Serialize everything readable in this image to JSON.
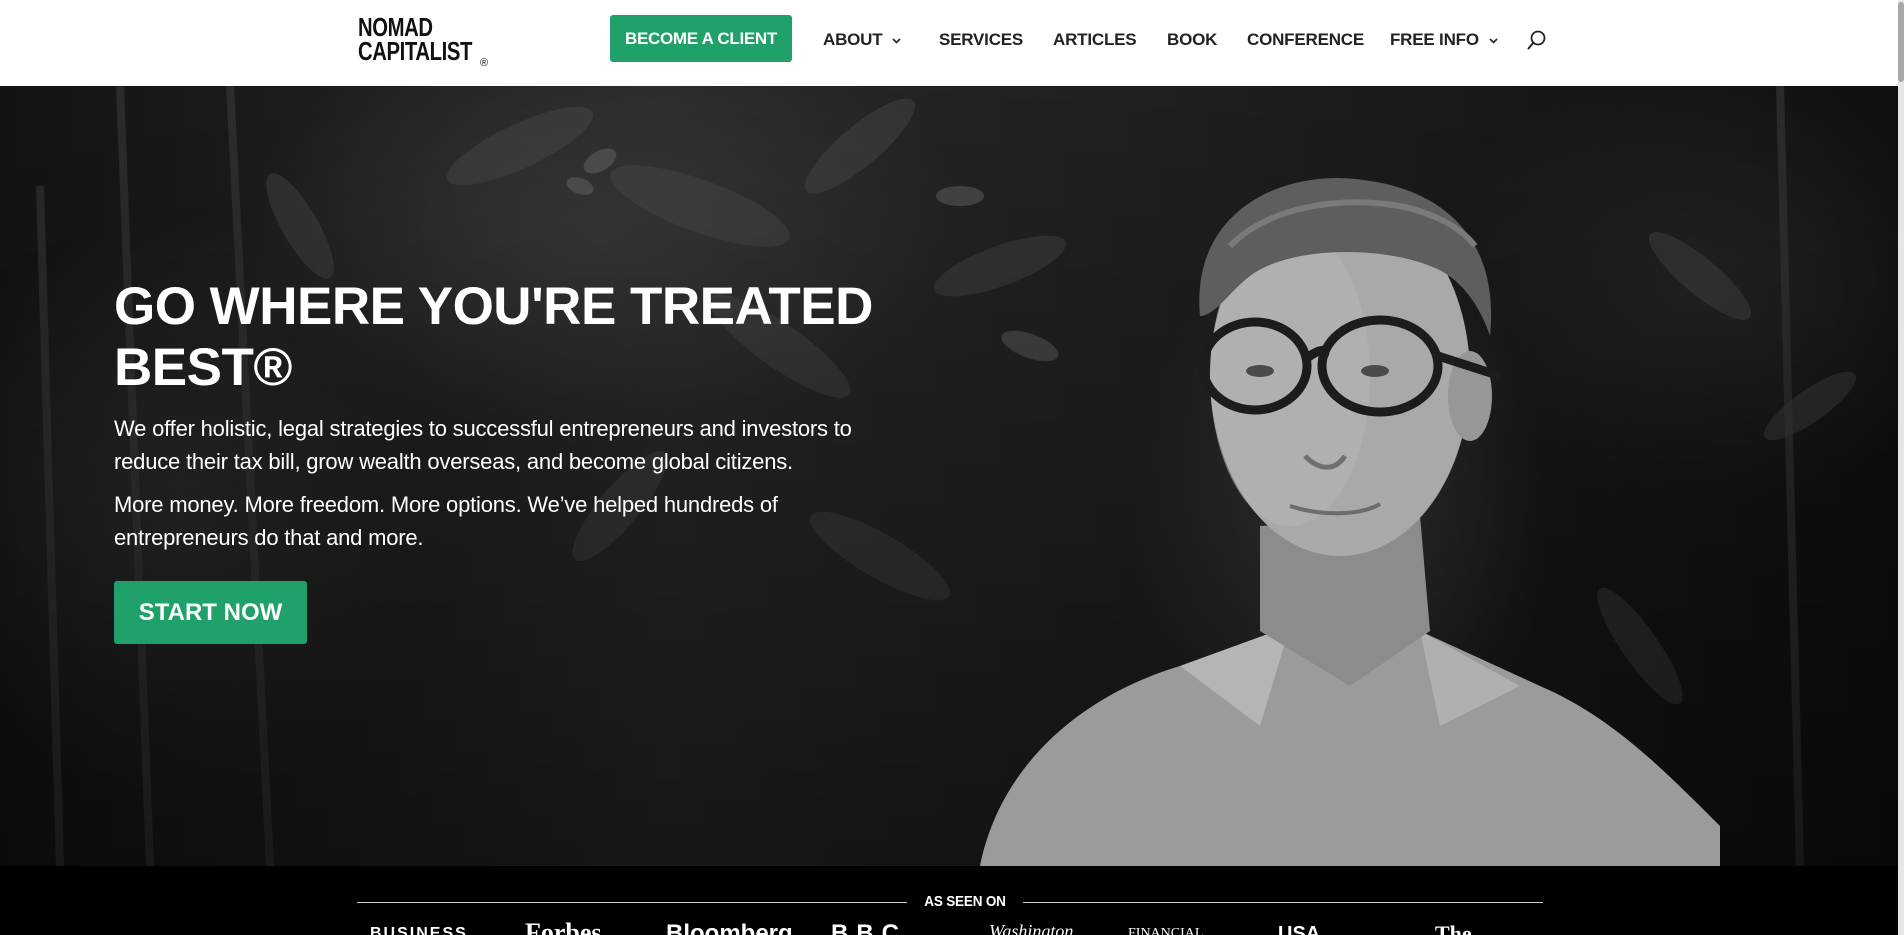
{
  "header": {
    "logo_line1": "NOMAD",
    "logo_line2": "CAPITALIST",
    "logo_reg": "®",
    "cta_label": "BECOME A CLIENT",
    "nav": [
      {
        "label": "ABOUT",
        "dropdown": true
      },
      {
        "label": "SERVICES",
        "dropdown": false
      },
      {
        "label": "ARTICLES",
        "dropdown": false
      },
      {
        "label": "BOOK",
        "dropdown": false
      },
      {
        "label": "CONFERENCE",
        "dropdown": false
      },
      {
        "label": "FREE INFO",
        "dropdown": true
      }
    ],
    "search_icon": "search-icon"
  },
  "hero": {
    "title_line1": "GO WHERE YOU'RE TREATED",
    "title_line2": "BEST®",
    "paragraph1_line1": "We offer holistic, legal strategies to successful entrepreneurs and investors to",
    "paragraph1_line2": "reduce their tax bill, grow wealth overseas, and become global citizens.",
    "paragraph2_line1": "More money. More freedom. More options. We’ve helped hundreds of",
    "paragraph2_line2": "entrepreneurs do that and more.",
    "cta_label": "START NOW"
  },
  "as_seen_on": {
    "label": "AS SEEN ON",
    "outlets": [
      "BUSINESS",
      "Forbes",
      "Bloomberg",
      "BBC",
      "Washington",
      "FINANCIAL",
      "USA",
      "The"
    ]
  },
  "colors": {
    "accent": "#1fa169",
    "header_bg": "#ffffff",
    "nav_text": "#222222",
    "hero_text": "#ffffff",
    "seen_bg": "#000000"
  }
}
